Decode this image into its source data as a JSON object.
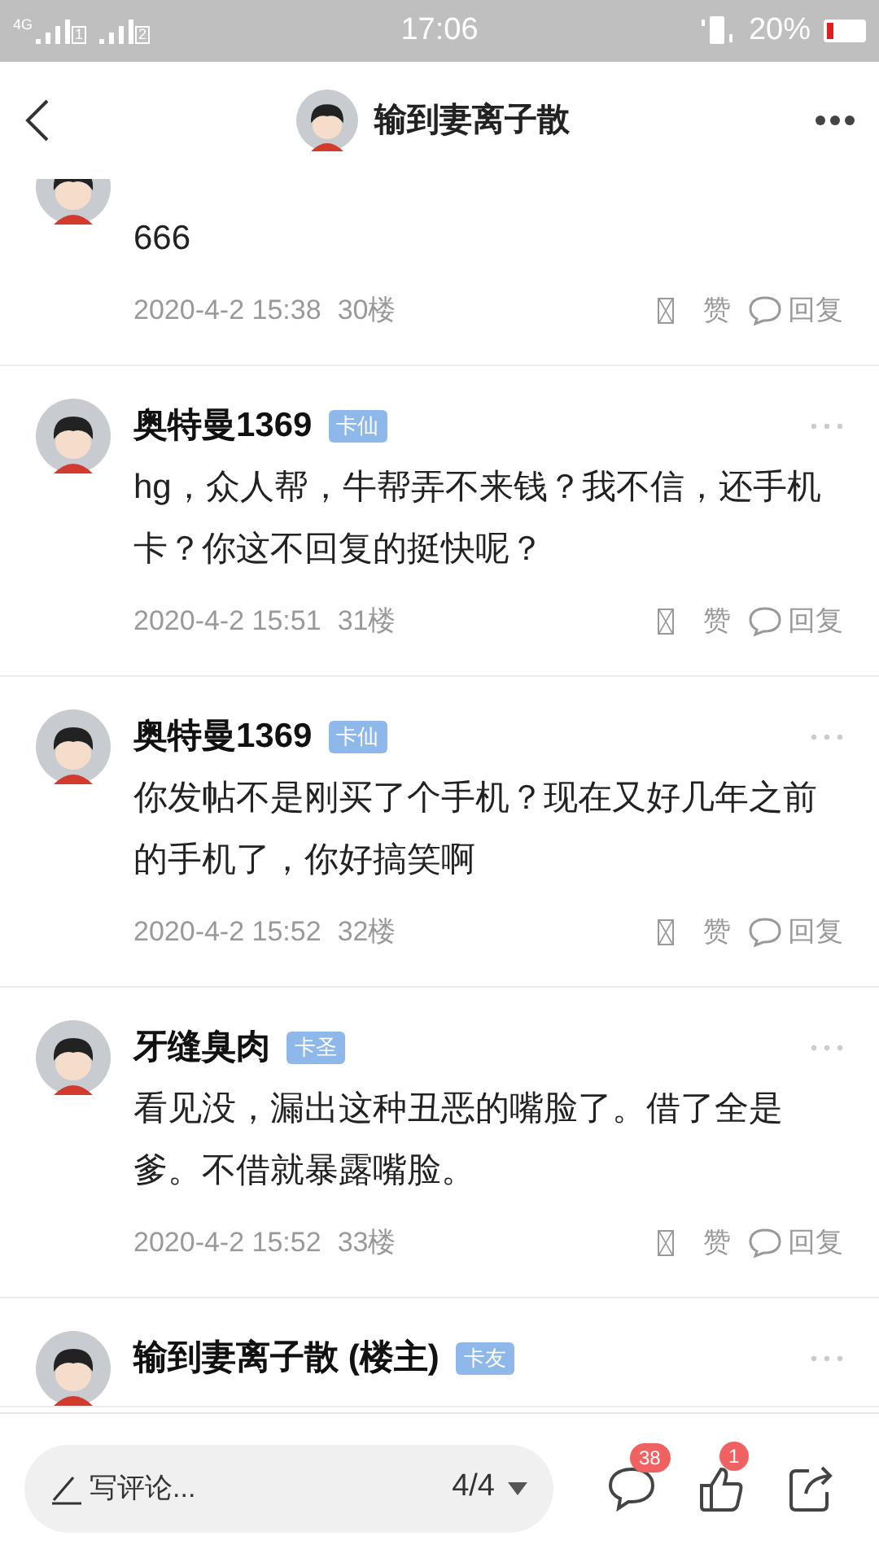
{
  "status_bar": {
    "network": "4G",
    "sim_1": "1",
    "sim_2": "2",
    "time": "17:06",
    "battery": "20%"
  },
  "header": {
    "title": "输到妻离子散"
  },
  "posts": [
    {
      "body": "666",
      "time": "2020-4-2 15:38",
      "floor": "30楼",
      "like_label": "赞",
      "reply_label": "回复"
    },
    {
      "author": "奥特曼1369",
      "badge": "卡仙",
      "body": "hg，众人帮，牛帮弄不来钱？我不信，还手机卡？你这不回复的挺快呢？",
      "time": "2020-4-2 15:51",
      "floor": "31楼",
      "like_label": "赞",
      "reply_label": "回复"
    },
    {
      "author": "奥特曼1369",
      "badge": "卡仙",
      "body": "你发帖不是刚买了个手机？现在又好几年之前的手机了，你好搞笑啊",
      "time": "2020-4-2 15:52",
      "floor": "32楼",
      "like_label": "赞",
      "reply_label": "回复"
    },
    {
      "author": "牙缝臭肉",
      "badge": "卡圣",
      "body": "看见没，漏出这种丑恶的嘴脸了。借了全是爹。不借就暴露嘴脸。",
      "time": "2020-4-2 15:52",
      "floor": "33楼",
      "like_label": "赞",
      "reply_label": "回复"
    },
    {
      "author": "输到妻离子散 (楼主)",
      "badge": "卡友"
    }
  ],
  "bottom_bar": {
    "compose_placeholder": "写评论...",
    "page": "4/4",
    "comment_count": "38",
    "like_count": "1"
  }
}
